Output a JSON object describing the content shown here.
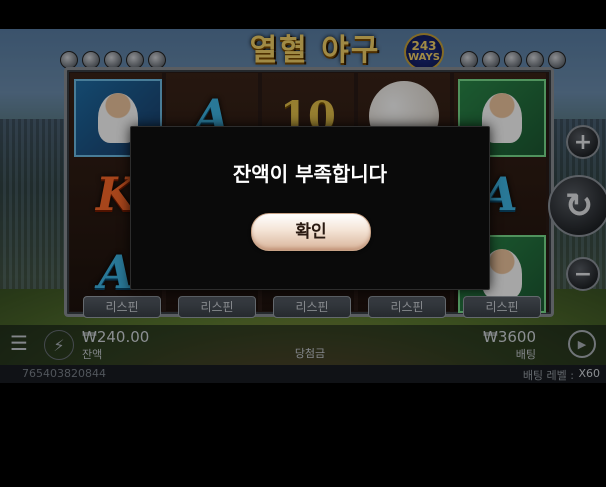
{
  "logo": {
    "title": "열혈 야구",
    "ways_count": "243",
    "ways_label": "WAYS"
  },
  "reels": [
    [
      "player-batter",
      "",
      ""
    ],
    [
      "A",
      "K",
      "A"
    ],
    [
      "10",
      "",
      ""
    ],
    [
      "baseball",
      "",
      ""
    ],
    [
      "player-catcher",
      "A",
      "player-catcher"
    ]
  ],
  "respin_buttons": [
    "리스핀",
    "리스핀",
    "리스핀",
    "리스핀",
    "리스핀"
  ],
  "controls": {
    "balance_value": "₩240.00",
    "balance_label": "잔액",
    "win_label": "당첨금",
    "bet_value": "₩3600",
    "bet_label": "배팅",
    "round_id": "765403820844",
    "bet_level_label": "배팅 레벨 :",
    "bet_level_value": "X60"
  },
  "modal": {
    "message": "잔액이 부족합니다",
    "confirm_label": "확인"
  },
  "colors": {
    "confirm_button_top": "#ffffff",
    "confirm_button_bottom": "#d9b49a",
    "modal_bg": "#0a0a0a"
  }
}
